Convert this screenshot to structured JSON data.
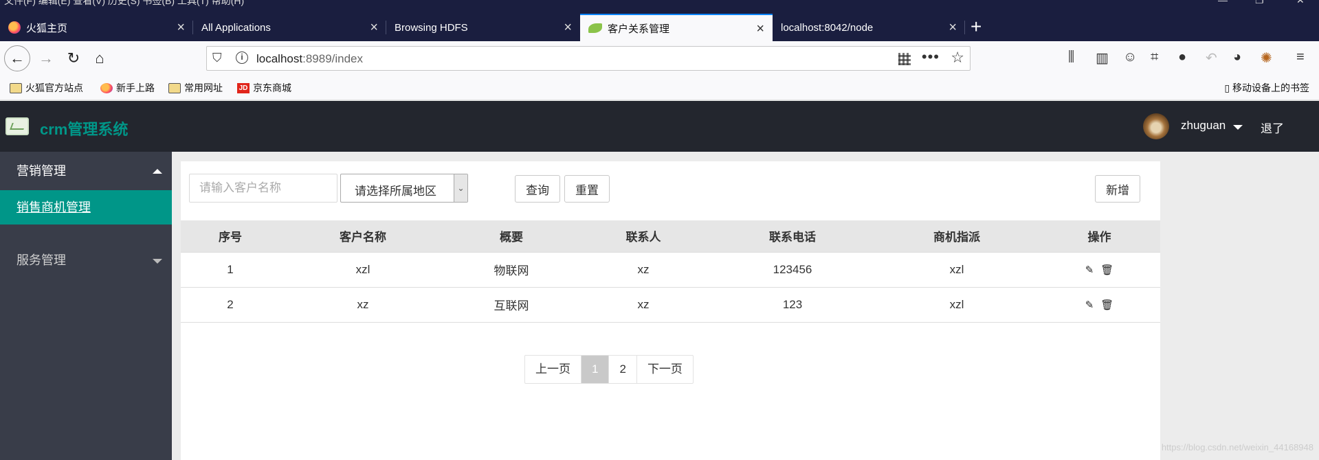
{
  "browser": {
    "menubar_text": "文件(F)  编辑(E)  查看(V)  历史(S)  书签(B)  工具(T)  帮助(H)",
    "tabs": [
      {
        "title": "火狐主页",
        "icon": "firefox-icon"
      },
      {
        "title": "All Applications",
        "icon": "none"
      },
      {
        "title": "Browsing HDFS",
        "icon": "none"
      },
      {
        "title": "客户关系管理",
        "icon": "spring-leaf-icon"
      },
      {
        "title": "localhost:8042/node",
        "icon": "none"
      }
    ],
    "url_host": "localhost",
    "url_path": ":8989/index",
    "bookmarks": [
      {
        "label": "火狐官方站点",
        "icon": "folder-icon"
      },
      {
        "label": "新手上路",
        "icon": "firefox-icon"
      },
      {
        "label": "常用网址",
        "icon": "folder-icon"
      },
      {
        "label": "京东商城",
        "icon": "jd-icon"
      }
    ],
    "jd_logo_text": "JD",
    "mobile_bookmarks": "移动设备上的书签"
  },
  "app": {
    "logo_text": "crm管理系统",
    "username": "zhuguan",
    "logout_label": "退了",
    "sidebar": {
      "group1": "营销管理",
      "active_item": "销售商机管理",
      "group2": "服务管理"
    },
    "search": {
      "name_placeholder": "请输入客户名称",
      "region_selected": "请选择所属地区",
      "query_label": "查询",
      "reset_label": "重置",
      "add_label": "新增"
    },
    "table": {
      "headers": [
        "序号",
        "客户名称",
        "概要",
        "联系人",
        "联系电话",
        "商机指派",
        "操作"
      ],
      "rows": [
        [
          "1",
          "xzl",
          "物联网",
          "xz",
          "123456",
          "xzl"
        ],
        [
          "2",
          "xz",
          "互联网",
          "xz",
          "123",
          "xzl"
        ]
      ]
    },
    "pager": {
      "prev": "上一页",
      "pages": [
        "1",
        "2"
      ],
      "next": "下一页"
    }
  },
  "watermark": "https://blog.csdn.net/weixin_44168948",
  "colors": {
    "accent": "#009688",
    "header_bg": "#23262e",
    "sidebar_bg": "#393d49",
    "tabstrip_bg": "#1a1e3f"
  }
}
